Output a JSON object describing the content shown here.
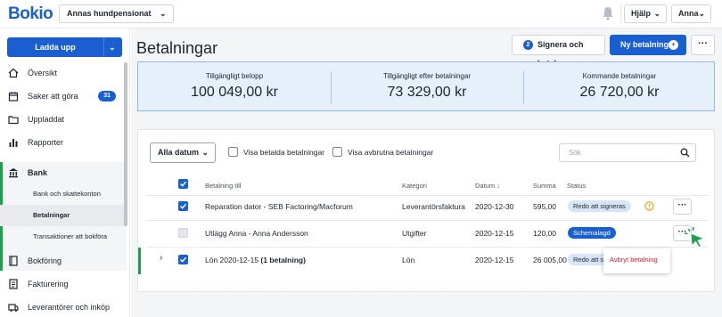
{
  "app": {
    "logo": "Bokio",
    "company": "Annas hundpensionat",
    "help": "Hjälp",
    "user": "Anna"
  },
  "sidebar": {
    "upload_label": "Ladda upp",
    "items": [
      {
        "label": "Översikt",
        "icon": "home-icon"
      },
      {
        "label": "Saker att göra",
        "icon": "calendar-icon",
        "badge": "31"
      },
      {
        "label": "Uppladdat",
        "icon": "folder-icon"
      },
      {
        "label": "Rapporter",
        "icon": "bar-chart-icon"
      },
      {
        "label": "Bank",
        "icon": "bank-icon"
      },
      {
        "label": "Bokföring",
        "icon": "book-icon"
      },
      {
        "label": "Fakturering",
        "icon": "invoice-icon"
      },
      {
        "label": "Leverantörer och inköp",
        "icon": "supplier-icon"
      }
    ],
    "bank_sub": [
      "Bank och skattekonton",
      "Betalningar",
      "Transaktioner att bokföra"
    ]
  },
  "main": {
    "title": "Betalningar",
    "sign_count": "2",
    "sign_label": "Signera och betala",
    "new_label": "Ny betalning",
    "summary": [
      {
        "title": "Tillgängligt belopp",
        "value": "100 049,00 kr"
      },
      {
        "title": "Tillgängligt efter betalningar",
        "value": "73 329,00 kr"
      },
      {
        "title": "Kommande betalningar",
        "value": "26 720,00 kr"
      }
    ],
    "filters": {
      "date": "Alla datum",
      "show_paid": "Visa betalda betalningar",
      "show_cancelled": "Visa avbrutna betalningar",
      "search_placeholder": "Sök"
    },
    "columns": {
      "to": "Betalning till",
      "category": "Kategori",
      "date": "Datum",
      "sum": "Summa",
      "status": "Status"
    },
    "rows": [
      {
        "to": "Reparation dator - SEB Factoring/Macforum",
        "category": "Leverantörsfaktura",
        "date": "2020-12-30",
        "sum": "595,00",
        "status": "Redo att signeras",
        "checked": true
      },
      {
        "to": "Utlägg Anna - Anna Andersson",
        "category": "Utgifter",
        "date": "2020-12-15",
        "sum": "120,00",
        "status": "Schemalagd",
        "checked": false
      },
      {
        "to_main": "Lön 2020-12-15",
        "to_extra": "(1 betalning)",
        "category": "Lön",
        "date": "2020-12-15",
        "sum": "26 005,00",
        "status": "Redo att sig",
        "checked": true
      }
    ],
    "menu_item": "Avbryt betalning"
  }
}
